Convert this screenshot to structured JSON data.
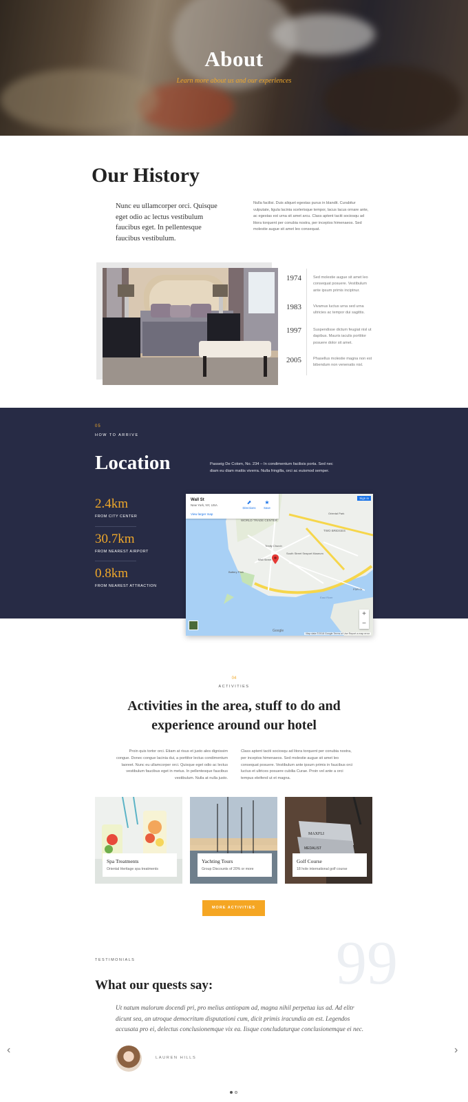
{
  "hero": {
    "title": "About",
    "subtitle": "Learn more about us and our experiences"
  },
  "history": {
    "title": "Our History",
    "lead": "Nunc eu ullamcorper orci. Quisque eget odio ac lectus vestibulum faucibus eget. In pellentesque faucibus vestibulum.",
    "body": "Nulla facilisi. Duis aliquet egestas purus in blandit. Curabitur vulputate, ligula lacinia scelerisque tempor, lacus lacus ornare ante, ac egestas est urna sit amet arcu. Class aptent taciti sociosqu ad litora torquent per conubia nostra, per inceptos himenaeos. Sed molestie augue sit amet leo consequat.",
    "timeline": [
      {
        "year": "1974",
        "text": "Sed molestie augue sit amet leo consequat posuere. Vestibulum ante ipsum primis inciptnur."
      },
      {
        "year": "1983",
        "text": "Vivamus luctus urna sed urna ultricies ac tempor dui sagittis."
      },
      {
        "year": "1997",
        "text": "Suspendisse dictum feugiat nisl ut dapibus. Mauris iaculis porttitor posuere dolor sit amet."
      },
      {
        "year": "2005",
        "text": "Phasellus molestie magna non est bibendum non venenatis nisl."
      }
    ]
  },
  "location": {
    "number": "05",
    "kicker": "HOW TO ARRIVE",
    "title": "Location",
    "description": "Passeig De Colom, No. 234 – In condimentum facilisis porta. Sed nec diam eu diam mattis viverra. Nulla fringilla, orci ac euismod semper.",
    "stats": [
      {
        "value": "2.4km",
        "label": "FROM CITY CENTER"
      },
      {
        "value": "30.7km",
        "label": "FROM NEAREST AIRPORT"
      },
      {
        "value": "0.8km",
        "label": "FROM NEAREST ATTRACTION"
      }
    ],
    "map": {
      "place": "Wall St",
      "address": "New York, NY, USA",
      "link": "View larger map",
      "directions": "Directions",
      "save": "Save",
      "signin": "Sign in",
      "zoom_in": "+",
      "zoom_out": "−",
      "logo": "Google",
      "attribution": "Map data ©2018 Google   Terms of Use   Report a map error",
      "labels": {
        "world_trade": "WORLD TRADE CENTER",
        "two_bridges": "TWO BRIDGES",
        "trinity": "Trinity Church",
        "wall_st": "Wall Street",
        "battery": "Battery Park",
        "oriental": "Oriental Park",
        "fdr": "FDR Dr",
        "east_river": "East River",
        "south_street": "South Street Seaport Museum"
      }
    }
  },
  "activities": {
    "number": "04",
    "kicker": "ACTIVITIES",
    "title": "Activities in the area, stuff to do and experience around our hotel",
    "left_text": "Proin quis tortor orci. Etiam at risus et justo ales dignissim congue. Donec congue lacinia dui, a porttitor lectus condimentum laoreet. Nunc eu ullamcorper orci. Quisque eget odio ac lectus vestibulum faucibus eget in metus. In pellentesque faucibus vestibulum. Nulla at nulla justo.",
    "right_text": "Class aptent taciti sociosqu ad litora torquent per conubia nostra, per inceptos himenaeos. Sed molestie augue sit amet leo consequat posuere. Vestibulum ante ipsum primis in faucibus orci luctus et ultrices posuere cubilia Curae. Proin vel ante a orci tempus eleifend ut et magna.",
    "cards": [
      {
        "title": "Spa Treatments",
        "subtitle": "Oriental Heritage spa treatments"
      },
      {
        "title": "Yachting Tours",
        "subtitle": "Group Discounts of 20% or more"
      },
      {
        "title": "Golf Course",
        "subtitle": "18 hole international golf course"
      }
    ],
    "button": "MORE ACTIVITIES",
    "golf_brand_1": "MAXFLI",
    "golf_brand_2": "MEDALIST"
  },
  "testimonials": {
    "kicker": "TESTIMONIALS",
    "title": "What our quests say:",
    "quote_mark": "99",
    "quote": "Ut natum malorum docendi pri, pro melius antiopam ad, magna nihil perpetua ius ad. Ad elitr dicunt sea, an utroque democritum disputationi cum, dicit primis iracundia an est. Legendos accusata pro ei, delectus conclusionemque vix ea. Iisque concludaturque conclusionemque ei nec.",
    "name": "LAUREN HILLS",
    "prev": "‹",
    "next": "›"
  },
  "colors": {
    "accent": "#f5a623",
    "navy": "#272b45"
  }
}
